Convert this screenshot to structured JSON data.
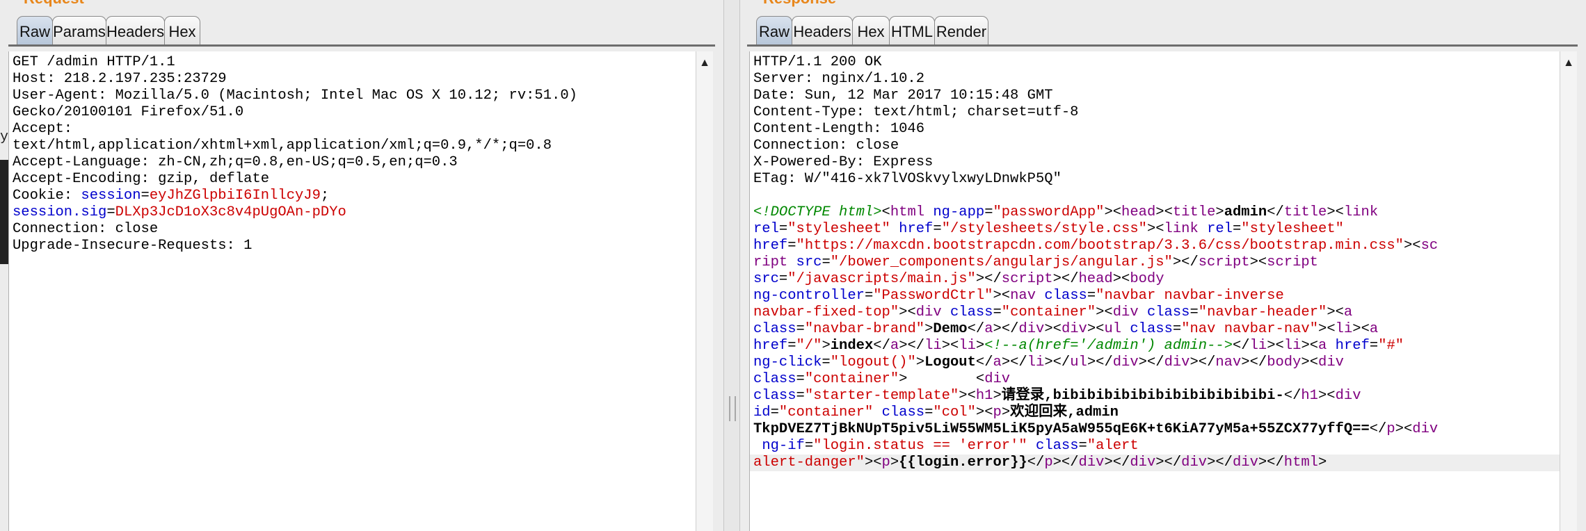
{
  "request": {
    "title": "Request",
    "tabs": [
      "Raw",
      "Params",
      "Headers",
      "Hex"
    ],
    "active_tab": "Raw",
    "lines": [
      "GET /admin HTTP/1.1",
      "Host: 218.2.197.235:23729",
      "User-Agent: Mozilla/5.0 (Macintosh; Intel Mac OS X 10.12; rv:51.0)",
      "Gecko/20100101 Firefox/51.0",
      "Accept:",
      "text/html,application/xhtml+xml,application/xml;q=0.9,*/*;q=0.8",
      "Accept-Language: zh-CN,zh;q=0.8,en-US;q=0.5,en;q=0.3",
      "Accept-Encoding: gzip, deflate",
      "Cookie: session=eyJhZGlpbiI6InllcyJ9;",
      "session.sig=DLXp3JcD1oX3c8v4pUgOAn-pDYo",
      "Connection: close",
      "Upgrade-Insecure-Requests: 1"
    ],
    "cookie": {
      "prefix": "Cookie: ",
      "name1": "session",
      "value1": "eyJhZGlpbiI6InllcyJ9",
      "suffix1": ";",
      "name2": "session.sig",
      "value2": "DLXp3JcD1oX3c8v4pUgOAn-pDYo"
    }
  },
  "response": {
    "title": "Response",
    "tabs": [
      "Raw",
      "Headers",
      "Hex",
      "HTML",
      "Render"
    ],
    "active_tab": "Raw",
    "headers": [
      "HTTP/1.1 200 OK",
      "Server: nginx/1.10.2",
      "Date: Sun, 12 Mar 2017 10:15:48 GMT",
      "Content-Type: text/html; charset=utf-8",
      "Content-Length: 1046",
      "Connection: close",
      "X-Powered-By: Express",
      "ETag: W/\"416-xk7lVOSkvylxwyLDnwkP5Q\""
    ],
    "body_text": {
      "doctype": "<!DOCTYPE html>",
      "title_text": "admin",
      "brand_text": "Demo",
      "index_text": "index",
      "comment_text": "<!--a(href='/admin') admin-->",
      "logout_text": "Logout",
      "h1_text": "请登录,bibibibibibibibibibibibibi-",
      "p_text": "欢迎回来,admin",
      "token_text": "TkpDVEZ7TjBkNUpT5piv5LiW55WM5LiK5pyA5aW955qE6K+t6KiA77yM5a+55ZCX77yffQ==",
      "error_expr": "{{login.error}}"
    }
  },
  "colors": {
    "accent_title": "#e8861a",
    "tag": "#800080",
    "attr": "#0000cc",
    "string": "#cc0000",
    "comment": "#008800"
  }
}
